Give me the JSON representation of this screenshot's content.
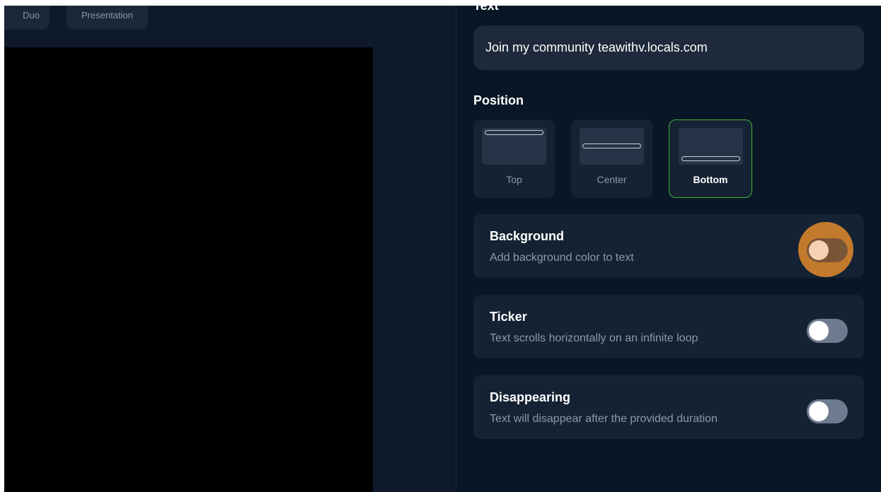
{
  "layouts": {
    "items": [
      {
        "label": "Duo"
      },
      {
        "label": "Presentation"
      }
    ]
  },
  "text_section": {
    "label": "Text",
    "value": "Join my community teawithv.locals.com"
  },
  "position_section": {
    "label": "Position",
    "options": [
      {
        "label": "Top",
        "selected": false
      },
      {
        "label": "Center",
        "selected": false
      },
      {
        "label": "Bottom",
        "selected": true
      }
    ]
  },
  "toggles": [
    {
      "title": "Background",
      "description": "Add background color to text",
      "enabled": false,
      "focused": true
    },
    {
      "title": "Ticker",
      "description": "Text scrolls horizontally on an infinite loop",
      "enabled": false,
      "focused": false
    },
    {
      "title": "Disappearing",
      "description": "Text will disappear after the provided duration",
      "enabled": false,
      "focused": false
    }
  ],
  "colors": {
    "app_background": "#0e1a29",
    "panel_background": "#081626",
    "card_background": "#142233",
    "selected_border": "#49b13a",
    "focus_ring": "#c47a2c"
  }
}
